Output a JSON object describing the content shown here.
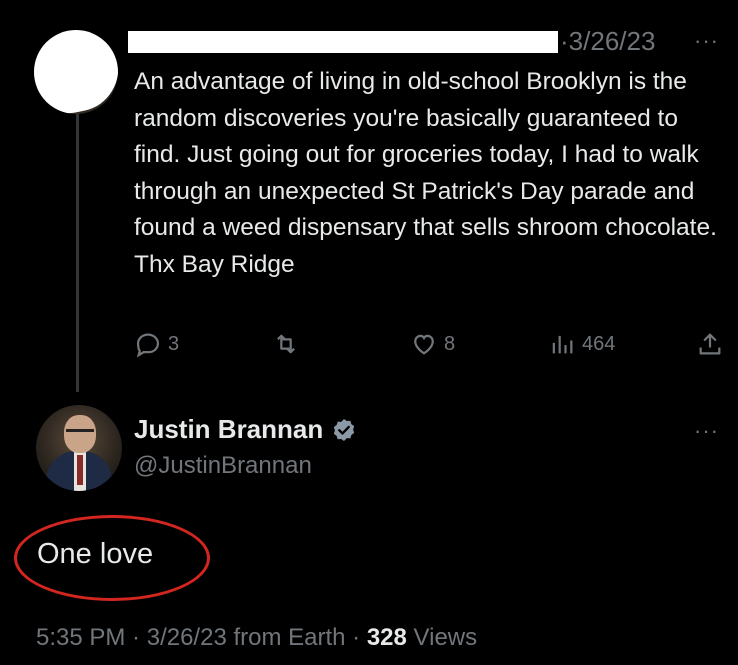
{
  "original_tweet": {
    "date": "3/26/23",
    "more_icon": "more-dots-icon",
    "text": "An advantage of living in old-school Brooklyn is the random discoveries you're basically guaranteed to find. Just going out for groceries today, I had to walk through an unexpected St Patrick's Day parade and found a weed dispensary that sells shroom chocolate. Thx Bay Ridge",
    "actions": {
      "replies": "3",
      "retweets": "",
      "likes": "8",
      "views": "464"
    }
  },
  "reply": {
    "name": "Justin Brannan",
    "handle": "@JustinBrannan",
    "text": "One love",
    "time": "5:35 PM",
    "date": "3/26/23",
    "source": "from Earth",
    "views_count": "328",
    "views_label": "Views"
  },
  "colors": {
    "background": "#000000",
    "text": "#e7e9ea",
    "muted": "#71767b",
    "verified": "#8b98a5",
    "annotation_circle": "#d2261f"
  }
}
